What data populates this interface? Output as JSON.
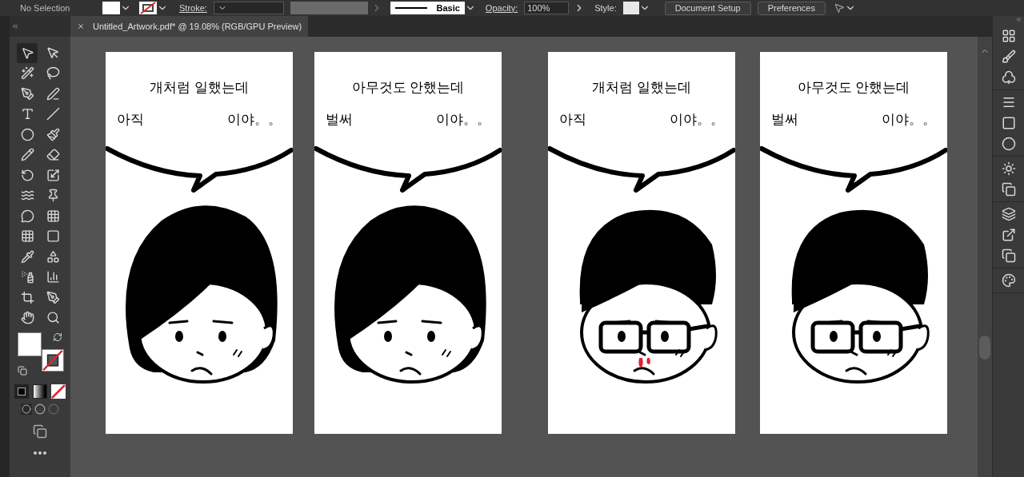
{
  "control_bar": {
    "selection": "No Selection",
    "stroke_label": "Stroke:",
    "profile": "Basic",
    "opacity_label": "Opacity:",
    "opacity": "100%",
    "style_label": "Style:",
    "buttons": [
      "Document Setup",
      "Preferences"
    ]
  },
  "document_tab": {
    "title": "Untitled_Artwork.pdf* @ 19.08% (RGB/GPU Preview)"
  },
  "artboards": [
    {
      "kind": "woman",
      "line1": "개처럼 일했는데",
      "left": "아직",
      "right": "이야。。",
      "glasses": false,
      "nosebleed": false
    },
    {
      "kind": "woman",
      "line1": "아무것도 안했는데",
      "left": "벌써",
      "right": "이야。。",
      "glasses": false,
      "nosebleed": false
    },
    {
      "kind": "man",
      "line1": "개처럼 일했는데",
      "left": "아직",
      "right": "이야。。",
      "glasses": true,
      "nosebleed": true
    },
    {
      "kind": "man",
      "line1": "아무것도 안했는데",
      "left": "벌써",
      "right": "이야。。",
      "glasses": true,
      "nosebleed": false
    }
  ]
}
